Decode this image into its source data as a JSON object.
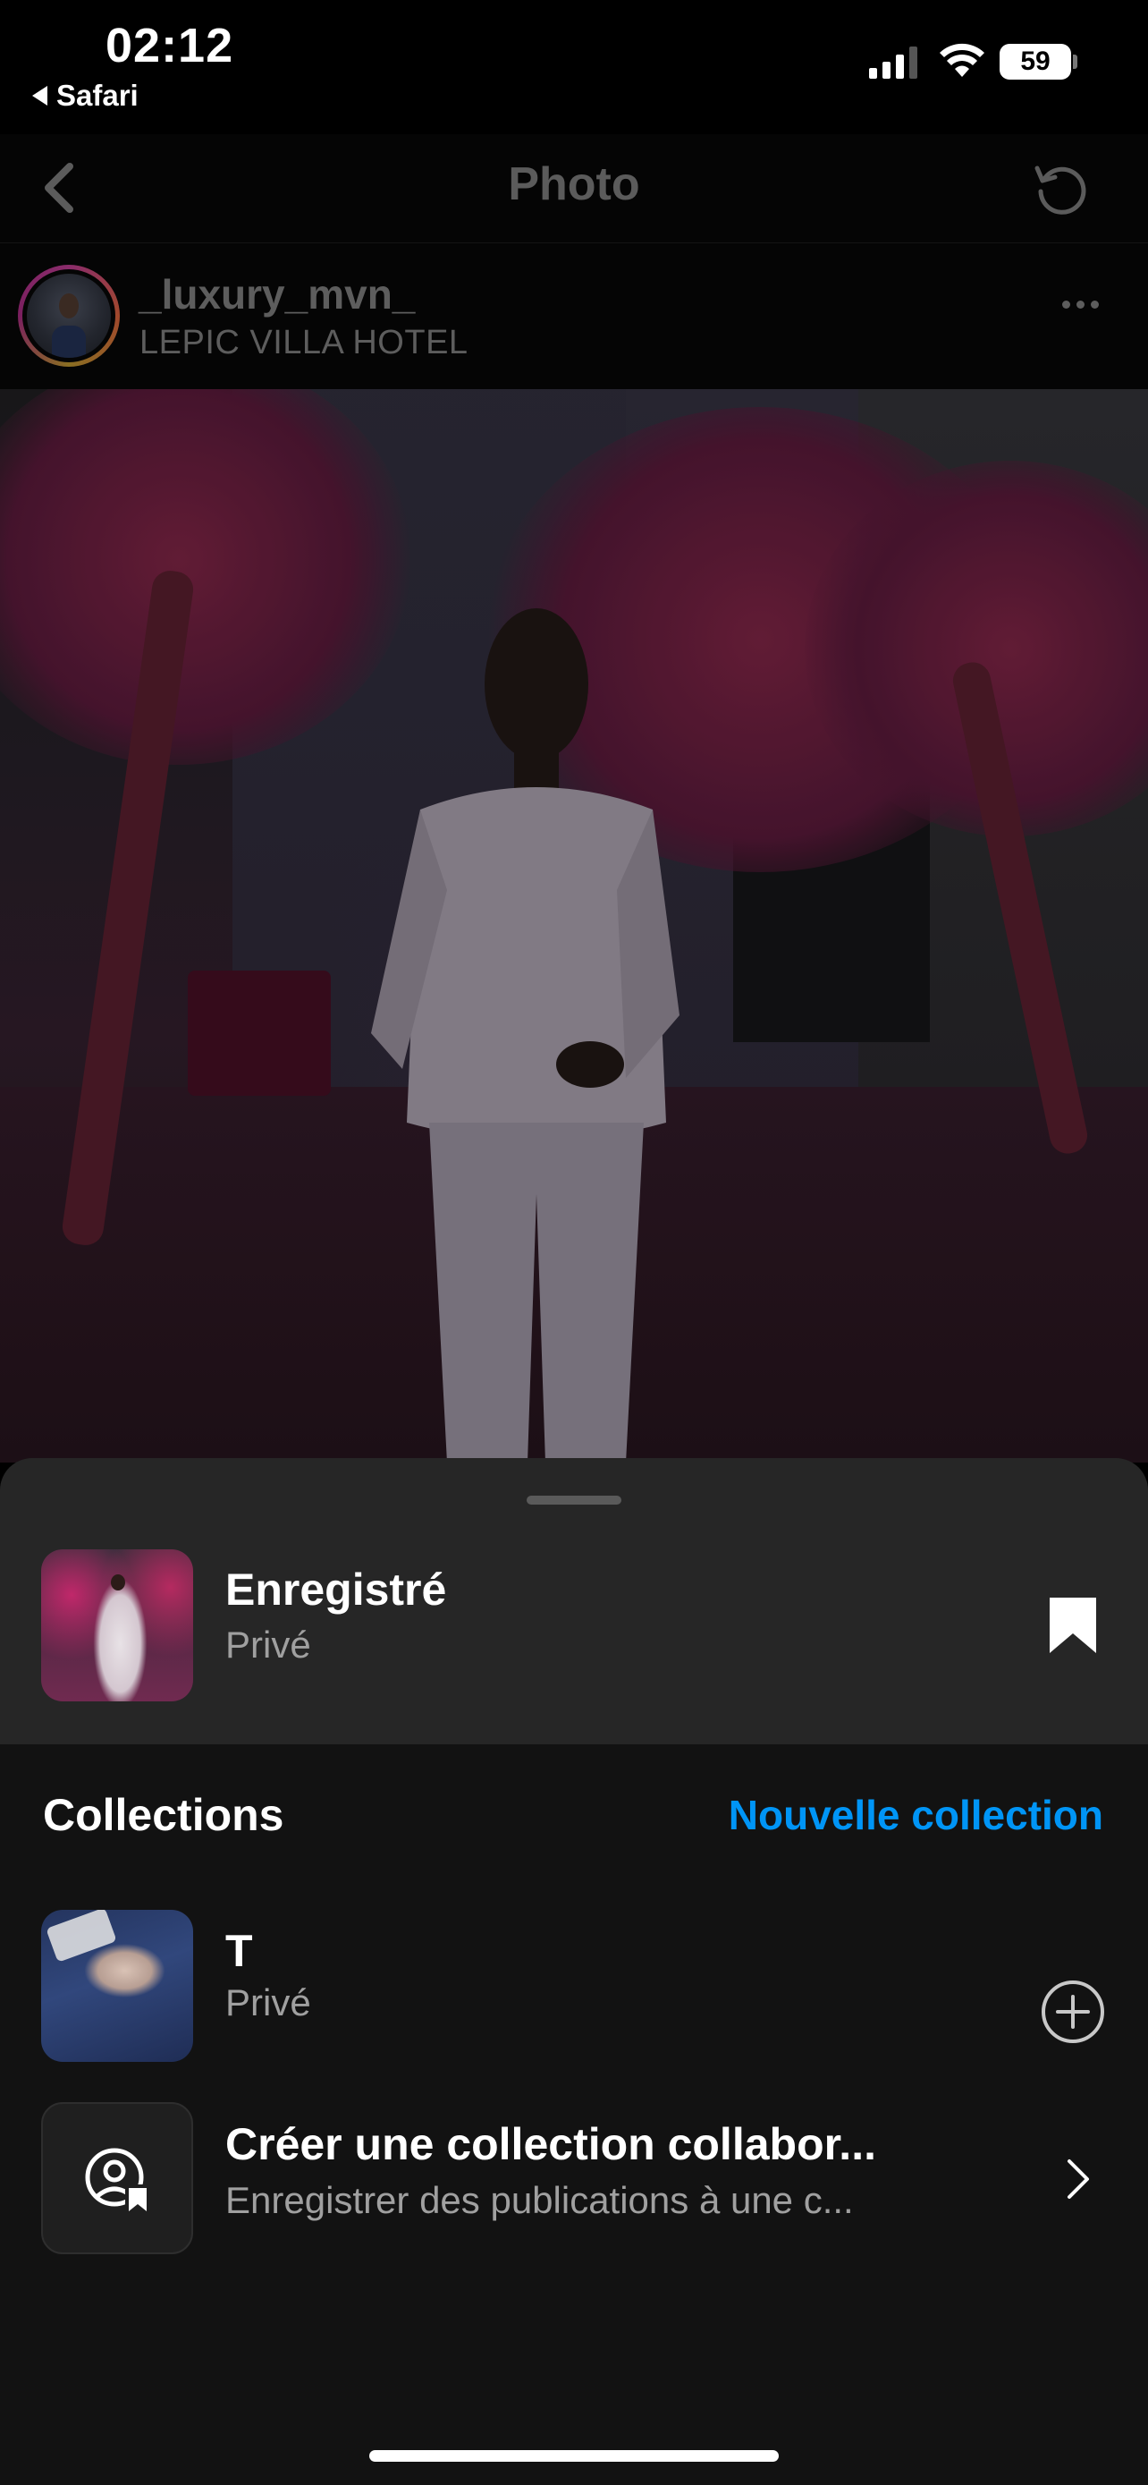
{
  "status_bar": {
    "time": "02:12",
    "back_app": "Safari",
    "battery": "59"
  },
  "nav": {
    "title": "Photo"
  },
  "post": {
    "username": "_luxury_mvn_",
    "location": "LEPIC VILLA HOTEL"
  },
  "sheet": {
    "saved": {
      "title": "Enregistré",
      "privacy": "Privé"
    },
    "collections_header": "Collections",
    "new_collection": "Nouvelle collection",
    "collections": [
      {
        "title": "T",
        "privacy": "Privé"
      }
    ],
    "collab": {
      "title": "Créer une collection collabor...",
      "subtitle": "Enregistrer des publications à une c..."
    }
  },
  "colors": {
    "accent": "#0095f6",
    "sheet_bg": "#121212",
    "saved_row_bg": "#262626",
    "secondary_text": "#a0a0a0"
  },
  "icons": {
    "nav_back": "chevron-left-icon",
    "nav_refresh": "refresh-icon",
    "more": "more-horizontal-icon",
    "bookmark": "bookmark-filled-icon",
    "add": "plus-circle-icon",
    "collab": "person-bookmark-icon",
    "chevron": "chevron-right-icon"
  }
}
